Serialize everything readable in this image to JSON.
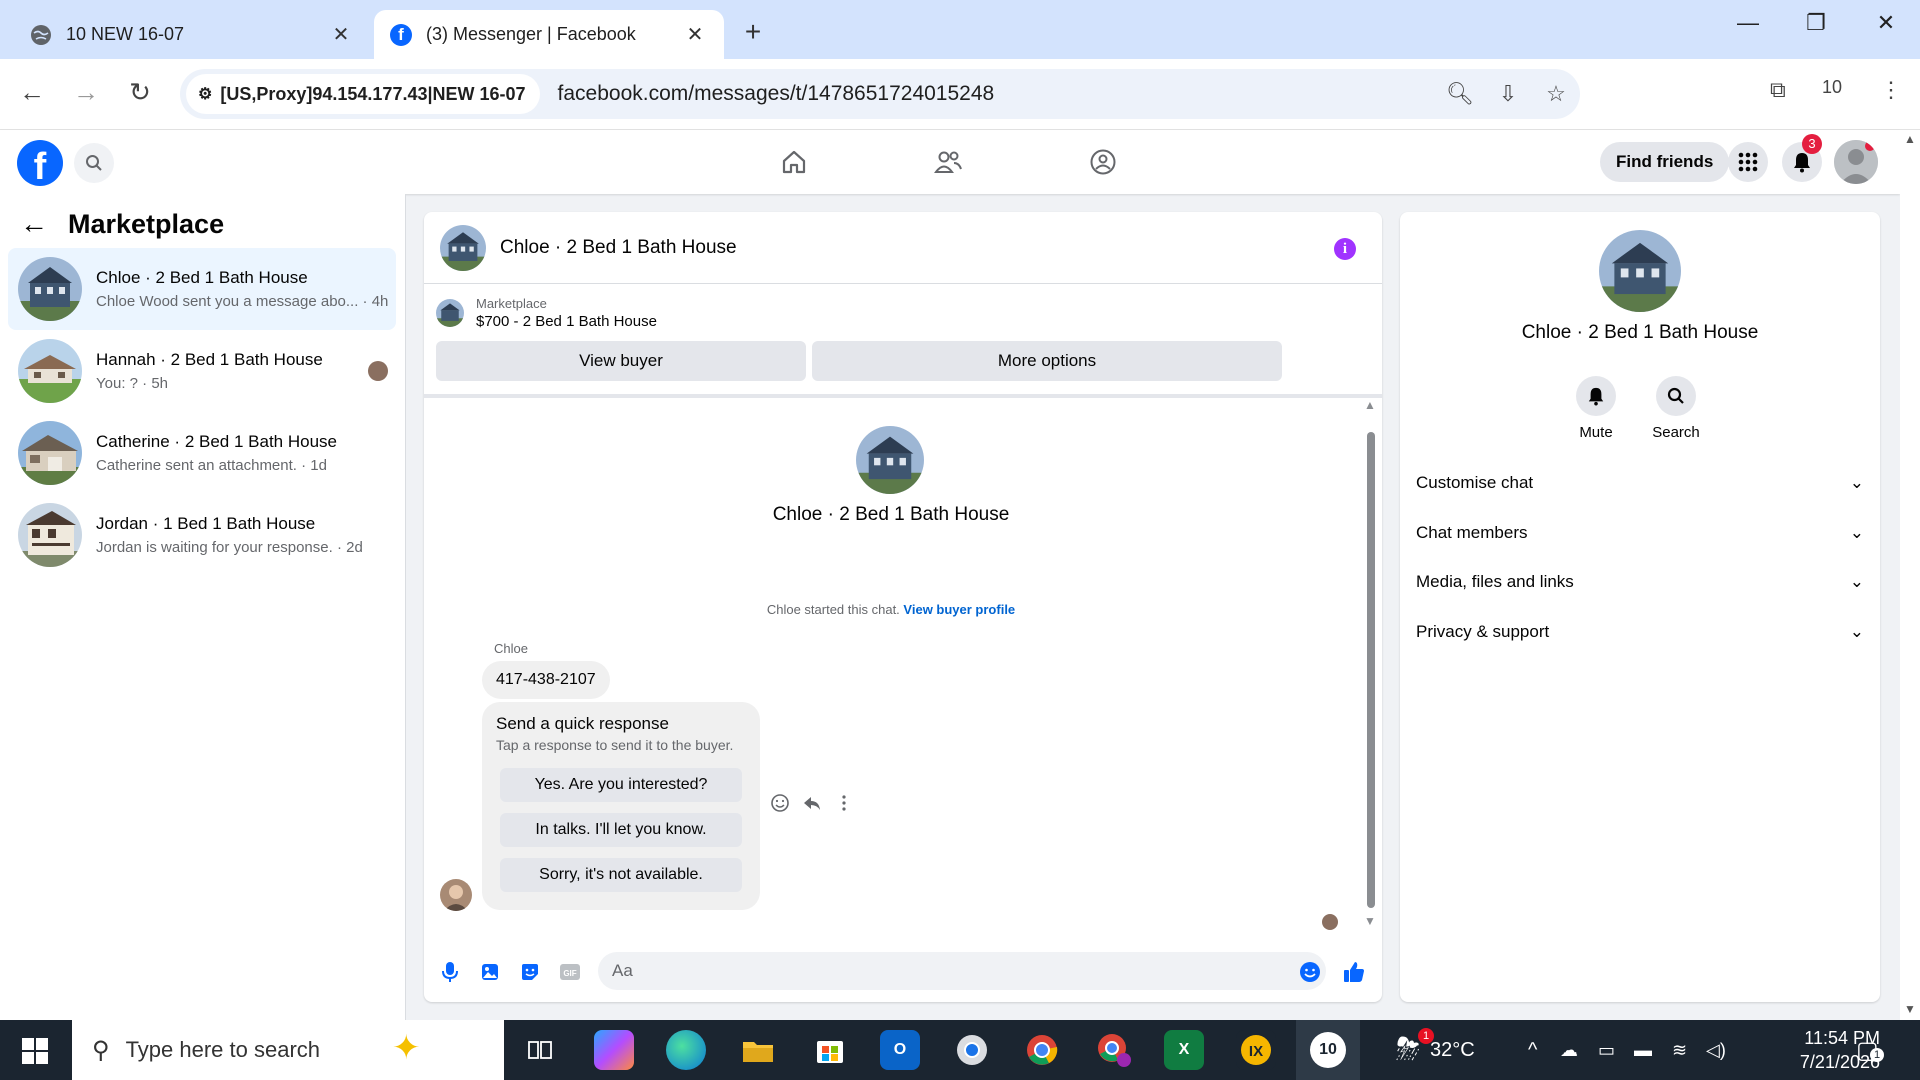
{
  "browser": {
    "tabs": [
      {
        "title": "10 NEW 16-07",
        "active": false
      },
      {
        "title": "(3) Messenger | Facebook",
        "active": true
      }
    ],
    "proxy_label": "[US,Proxy]94.154.177.43|NEW 16-07",
    "url": "facebook.com/messages/t/1478651724015248",
    "extension_count": "10"
  },
  "fb_header": {
    "find_friends_label": "Find friends",
    "notification_count": "3"
  },
  "sidebar": {
    "title": "Marketplace",
    "conversations": [
      {
        "name": "Chloe · 2 Bed 1 Bath House",
        "preview": "Chloe Wood sent you a message abo... · 4h",
        "active": true
      },
      {
        "name": "Hannah · 2 Bed 1 Bath House",
        "preview": "You: ? · 5h",
        "active": false
      },
      {
        "name": "Catherine · 2 Bed 1 Bath House",
        "preview": "Catherine sent an attachment. · 1d",
        "active": false
      },
      {
        "name": "Jordan · 1 Bed 1 Bath House",
        "preview": "Jordan is waiting for your response. · 2d",
        "active": false
      }
    ]
  },
  "chat": {
    "title": "Chloe · 2 Bed 1 Bath House",
    "marketplace_label": "Marketplace",
    "listing": "$700 - 2 Bed 1 Bath House",
    "view_buyer_label": "View buyer",
    "more_options_label": "More options",
    "center_name": "Chloe · 2 Bed 1 Bath House",
    "started_text": "Chloe started this chat.",
    "view_profile_link": "View buyer profile",
    "sender_name": "Chloe",
    "message": "417-438-2107",
    "quick_response": {
      "title": "Send a quick response",
      "subtitle": "Tap a response to send it to the buyer.",
      "options": [
        "Yes. Are you interested?",
        "In talks. I'll let you know.",
        "Sorry, it's not available."
      ]
    },
    "composer_placeholder": "Aa"
  },
  "right_panel": {
    "name": "Chloe · 2 Bed 1 Bath House",
    "actions": [
      {
        "label": "Mute",
        "icon": "bell-icon"
      },
      {
        "label": "Search",
        "icon": "search-icon"
      }
    ],
    "sections": [
      "Customise chat",
      "Chat members",
      "Media, files and links",
      "Privacy & support"
    ]
  },
  "taskbar": {
    "search_placeholder": "Type here to search",
    "weather": "32°C",
    "weather_badge": "1",
    "time": "11:54 PM",
    "date": "7/21/2026",
    "notification_count": "1",
    "active_app_label": "10"
  },
  "colors": {
    "fb_blue": "#0866ff",
    "link_blue": "#0064d1",
    "info_purple": "#a033ff",
    "notification_red": "#e41e3f"
  }
}
